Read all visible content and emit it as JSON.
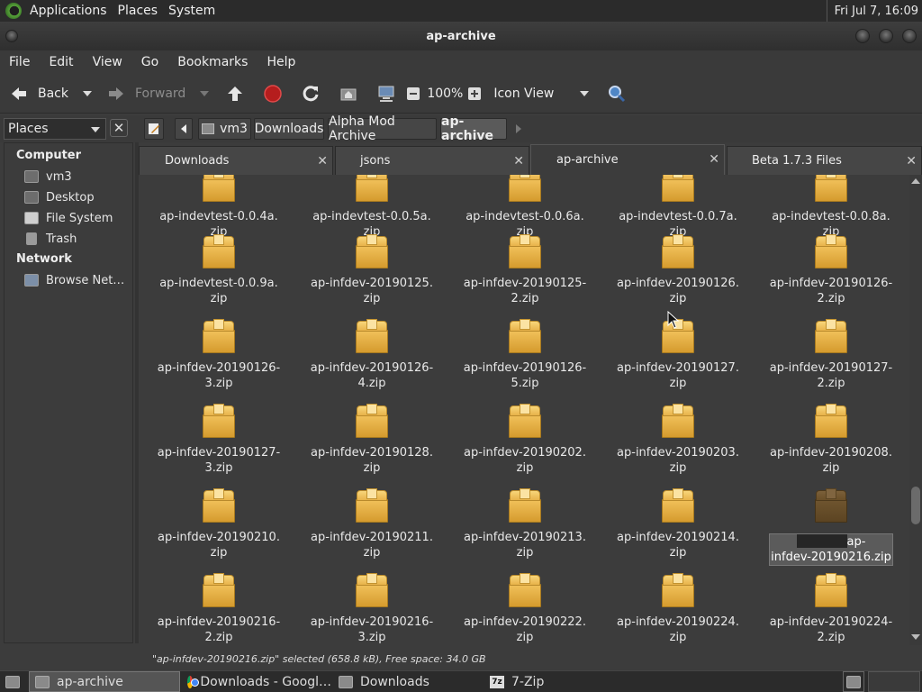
{
  "top_panel": {
    "menus": [
      "Applications",
      "Places",
      "System"
    ],
    "clock": "Fri Jul  7, 16:09"
  },
  "window": {
    "title": "ap-archive"
  },
  "menubar": [
    "File",
    "Edit",
    "View",
    "Go",
    "Bookmarks",
    "Help"
  ],
  "toolbar": {
    "back": "Back",
    "forward": "Forward",
    "zoom": "100%",
    "view_mode": "Icon View"
  },
  "places_combo": "Places",
  "path": [
    "vm3",
    "Downloads",
    "Alpha Mod Archive",
    "ap-archive"
  ],
  "sidebar": {
    "computer_heading": "Computer",
    "computer_items": [
      "vm3",
      "Desktop",
      "File System",
      "Trash"
    ],
    "network_heading": "Network",
    "network_items": [
      "Browse Net…"
    ]
  },
  "tabs": [
    "Downloads",
    "jsons",
    "ap-archive",
    "Beta 1.7.3 Files"
  ],
  "active_tab": "ap-archive",
  "files": [
    "ap-indevtest-0.0.4a.\nzip",
    "ap-indevtest-0.0.5a.\nzip",
    "ap-indevtest-0.0.6a.\nzip",
    "ap-indevtest-0.0.7a.\nzip",
    "ap-indevtest-0.0.8a.\nzip",
    "ap-indevtest-0.0.9a.\nzip",
    "ap-infdev-20190125.\nzip",
    "ap-infdev-20190125-\n2.zip",
    "ap-infdev-20190126.\nzip",
    "ap-infdev-20190126-\n2.zip",
    "ap-infdev-20190126-\n3.zip",
    "ap-infdev-20190126-\n4.zip",
    "ap-infdev-20190126-\n5.zip",
    "ap-infdev-20190127.\nzip",
    "ap-infdev-20190127-\n2.zip",
    "ap-infdev-20190127-\n3.zip",
    "ap-infdev-20190128.\nzip",
    "ap-infdev-20190202.\nzip",
    "ap-infdev-20190203.\nzip",
    "ap-infdev-20190208.\nzip",
    "ap-infdev-20190210.\nzip",
    "ap-infdev-20190211.\nzip",
    "ap-infdev-20190213.\nzip",
    "ap-infdev-20190214.\nzip",
    "ap-infdev-20190216.zip",
    "ap-infdev-20190216-\n2.zip",
    "ap-infdev-20190216-\n3.zip",
    "ap-infdev-20190222.\nzip",
    "ap-infdev-20190224.\nzip",
    "ap-infdev-20190224-\n2.zip"
  ],
  "selected_file": {
    "line1": "ap-",
    "line2": "infdev-20190216.zip"
  },
  "status": "\"ap-infdev-20190216.zip\" selected (658.8 kB), Free space: 34.0 GB",
  "taskbar": {
    "tasks": [
      "ap-archive",
      "Downloads - Googl…",
      "Downloads",
      "7-Zip"
    ],
    "zip_icon_label": "7z"
  }
}
